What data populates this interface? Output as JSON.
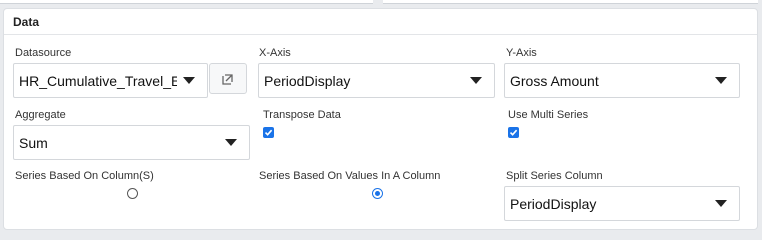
{
  "panel": {
    "title": "Data"
  },
  "datasource": {
    "label": "Datasource",
    "value": "HR_Cumulative_Travel_E"
  },
  "x_axis": {
    "label": "X-Axis",
    "value": "PeriodDisplay"
  },
  "y_axis": {
    "label": "Y-Axis",
    "value": "Gross Amount"
  },
  "aggregate": {
    "label": "Aggregate",
    "value": "Sum"
  },
  "transpose": {
    "label": "Transpose Data",
    "checked": true
  },
  "multi_series": {
    "label": "Use Multi Series",
    "checked": true
  },
  "series_by_columns": {
    "label": "Series Based On Column(S)",
    "selected": false
  },
  "series_by_values": {
    "label": "Series Based On Values In A Column",
    "selected": true
  },
  "split_series": {
    "label": "Split Series Column",
    "value": "PeriodDisplay"
  },
  "icons": {
    "expand": "expand-arrow-icon",
    "caret": "chevron-down-icon",
    "check": "checkmark-icon"
  },
  "colors": {
    "accent": "#1a73e8",
    "border": "#d4d7db",
    "background": "#e9ebee"
  }
}
